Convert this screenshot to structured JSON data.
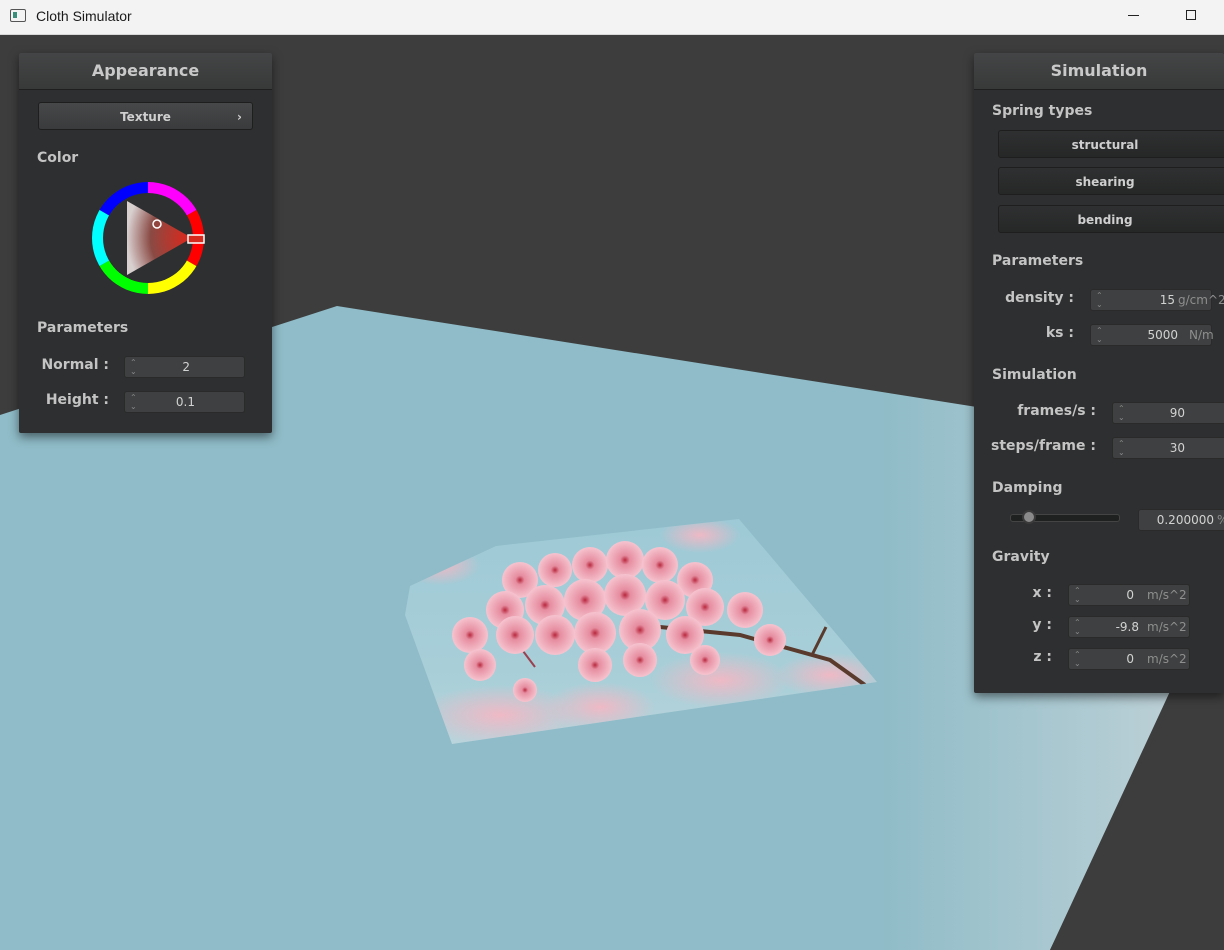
{
  "window": {
    "title": "Cloth Simulator"
  },
  "appearance": {
    "header": "Appearance",
    "texture_button": "Texture",
    "texture_chevron": "›",
    "color_label": "Color",
    "color_value": "#d62a1e",
    "parameters_label": "Parameters",
    "normal": {
      "label": "Normal :",
      "value": "2"
    },
    "height": {
      "label": "Height :",
      "value": "0.1"
    }
  },
  "simulation": {
    "header": "Simulation",
    "spring_types_label": "Spring types",
    "springs": [
      "structural",
      "shearing",
      "bending"
    ],
    "parameters_label": "Parameters",
    "density": {
      "label": "density :",
      "value": "15",
      "unit": "g/cm^2"
    },
    "ks": {
      "label": "ks :",
      "value": "5000",
      "unit": "N/m"
    },
    "simulation_label": "Simulation",
    "fps": {
      "label": "frames/s :",
      "value": "90"
    },
    "steps": {
      "label": "steps/frame :",
      "value": "30"
    },
    "damping_label": "Damping",
    "damping": {
      "value": "0.200000",
      "unit": "%",
      "fraction": 0.1
    },
    "gravity_label": "Gravity",
    "gx": {
      "label": "x :",
      "value": "0",
      "unit": "m/s^2"
    },
    "gy": {
      "label": "y :",
      "value": "-9.8",
      "unit": "m/s^2"
    },
    "gz": {
      "label": "z :",
      "value": "0",
      "unit": "m/s^2"
    }
  },
  "scene": {
    "floor_color": "#8fbcc8",
    "background_color": "#3d3d3d",
    "cloth_texture": "cherry-blossom"
  }
}
